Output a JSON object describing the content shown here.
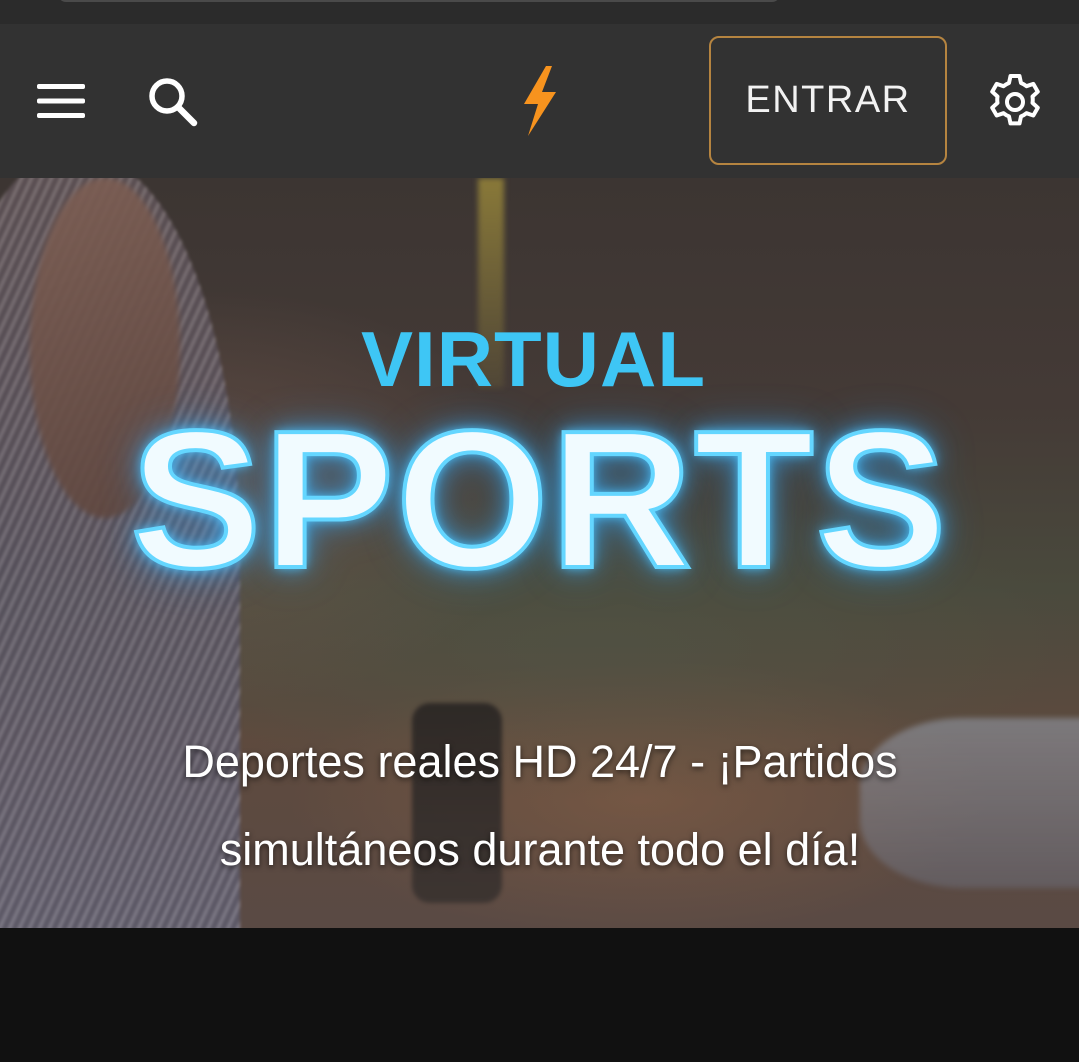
{
  "header": {
    "menu_icon": "hamburger-menu-icon",
    "search_icon": "search-icon",
    "logo_icon": "lightning-bolt-logo",
    "login_label": "ENTRAR",
    "settings_icon": "gear-icon"
  },
  "hero": {
    "title_top": "VIRTUAL",
    "title_main": "SPORTS",
    "tagline": "Deportes reales HD 24/7 - ¡Partidos simultáneos durante todo el día!"
  },
  "colors": {
    "header_bg": "#323232",
    "accent_orange": "#f7931e",
    "login_border": "#b58440",
    "virtual_blue": "#3ec6f5",
    "sports_glow": "#64d6ff",
    "page_bg": "#111111"
  }
}
